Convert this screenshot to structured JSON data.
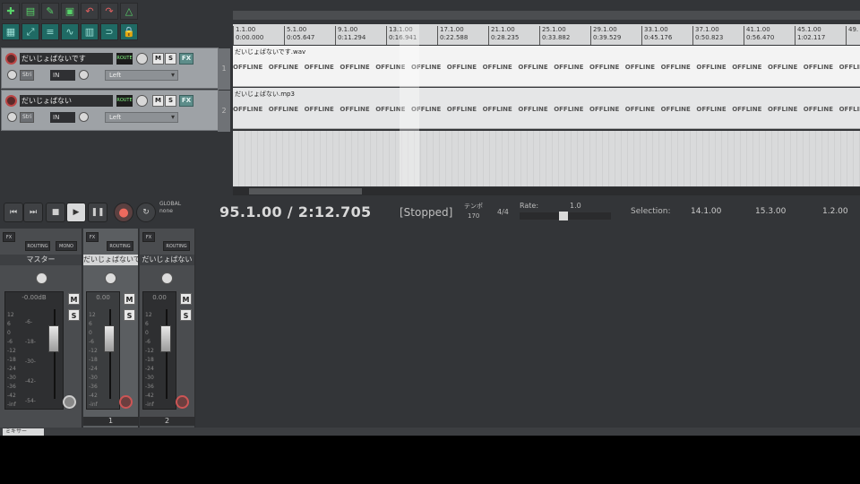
{
  "toolbar": {
    "buttons": [
      {
        "icon": "new-project-icon",
        "glyph": "✚"
      },
      {
        "icon": "open-project-icon",
        "glyph": "▤"
      },
      {
        "icon": "save-project-icon",
        "glyph": "✎"
      },
      {
        "icon": "project-settings-icon",
        "glyph": "▣"
      },
      {
        "icon": "undo-icon",
        "glyph": "↶"
      },
      {
        "icon": "redo-icon",
        "glyph": "↷"
      },
      {
        "icon": "metronome-icon",
        "glyph": "△"
      },
      {
        "icon": "grid-icon",
        "glyph": "▦"
      },
      {
        "icon": "snap-icon",
        "glyph": "⤢"
      },
      {
        "icon": "ripple-icon",
        "glyph": "≡"
      },
      {
        "icon": "envelope-icon",
        "glyph": "∿"
      },
      {
        "icon": "item-grouping-icon",
        "glyph": "▥"
      },
      {
        "icon": "loop-icon",
        "glyph": "⊃"
      },
      {
        "icon": "lock-icon",
        "glyph": "🔒"
      }
    ]
  },
  "tracks": [
    {
      "name": "だいじょばないです",
      "number": "1",
      "fx": "FX",
      "mute": "M",
      "solo": "S",
      "input": "IN",
      "pan": "Left",
      "route": "ROUTE",
      "mono": "Stri"
    },
    {
      "name": "だいじょばない",
      "number": "2",
      "fx": "FX",
      "mute": "M",
      "solo": "S",
      "input": "IN",
      "pan": "Left",
      "route": "ROUTE",
      "mono": "Stri"
    }
  ],
  "ruler": {
    "ticks": [
      {
        "bar": "1.1.00",
        "time": "0:00.000"
      },
      {
        "bar": "5.1.00",
        "time": "0:05.647"
      },
      {
        "bar": "9.1.00",
        "time": "0:11.294"
      },
      {
        "bar": "13.1.00",
        "time": "0:16.941"
      },
      {
        "bar": "17.1.00",
        "time": "0:22.588"
      },
      {
        "bar": "21.1.00",
        "time": "0:28.235"
      },
      {
        "bar": "25.1.00",
        "time": "0:33.882"
      },
      {
        "bar": "29.1.00",
        "time": "0:39.529"
      },
      {
        "bar": "33.1.00",
        "time": "0:45.176"
      },
      {
        "bar": "37.1.00",
        "time": "0:50.823"
      },
      {
        "bar": "41.1.00",
        "time": "0:56.470"
      },
      {
        "bar": "45.1.00",
        "time": "1:02.117"
      },
      {
        "bar": "49.",
        "time": ""
      }
    ]
  },
  "items": [
    {
      "name": "だいじょばないです.wav",
      "offline_label": "OFFLINE"
    },
    {
      "name": "だいじょばない.mp3",
      "offline_label": "OFFLINE"
    }
  ],
  "transport": {
    "position": "95.1.00 / 2:12.705",
    "status": "[Stopped]",
    "tempo_label": "テンポ",
    "tempo": "170",
    "time_signature": "4/4",
    "rate_label": "Rate:",
    "rate_value": "1.0",
    "global_label": "GLOBAL",
    "global_sub": "none",
    "selection_label": "Selection:",
    "selection_start": "14.1.00",
    "selection_end": "15.3.00",
    "selection_length": "1.2.00"
  },
  "mixer": {
    "tab_label": "ミキサー",
    "strips": [
      {
        "name": "マスター",
        "db": "-0.00dB",
        "number": "",
        "routing": "ROUTING",
        "mono": "MONO",
        "fx": "FX"
      },
      {
        "name": "だいじょばないで",
        "db": "0.00",
        "number": "1",
        "routing": "ROUTING",
        "fx": "FX"
      },
      {
        "name": "だいじょばない",
        "db": "0.00",
        "number": "2",
        "routing": "ROUTING",
        "fx": "FX"
      }
    ],
    "scale": [
      "12",
      "6",
      "0",
      "-6",
      "-12",
      "-18",
      "-24",
      "-30",
      "-36",
      "-42",
      "-inf"
    ],
    "master_scale_inner": [
      "-6-",
      "-18-",
      "-30-",
      "-42-",
      "-54-"
    ],
    "mute_label": "M",
    "solo_label": "S"
  },
  "colors": {
    "background": "#333538",
    "accent_teal": "#5d8d8a",
    "record_red": "#cc5555"
  }
}
